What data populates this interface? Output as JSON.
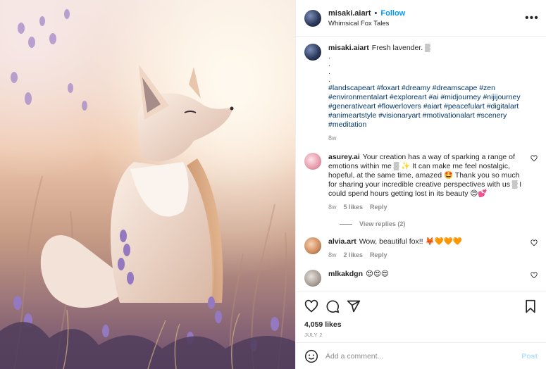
{
  "header": {
    "username": "misaki.aiart",
    "separator": "•",
    "follow_label": "Follow",
    "subtitle": "Whimsical Fox Tales",
    "more_label": "•••"
  },
  "caption": {
    "username": "misaki.aiart",
    "text": "Fresh lavender. ▒",
    "dots": [
      ".",
      ".",
      ".",
      "."
    ],
    "hashtags": "#landscapeart #foxart #dreamy #dreamscape #zen #environmentalart #exploreart #ai #midjourney #nijijourney #generativeart #flowerlovers #aiart #peacefulart #digitalart #animeartstyle #visionaryart #motivationalart #scenery #meditation",
    "age": "8w"
  },
  "comments": [
    {
      "username": "asurey.ai",
      "text": "Your creation has a way of sparking a range of emotions within me ▒ ✨ It can make me feel nostalgic, hopeful, at the same time, amazed 🤩 Thank you so much for sharing your incredible creative perspectives with us ▒ I could spend hours getting lost in its beauty 😍💕",
      "age": "8w",
      "likes": "5 likes",
      "reply": "Reply",
      "view_replies": "View replies (2)"
    },
    {
      "username": "alvia.art",
      "text": "Wow, beautiful fox!! 🦊🧡🧡🧡",
      "age": "8w",
      "likes": "2 likes",
      "reply": "Reply"
    },
    {
      "username": "mlkakdgn",
      "text": "😍😍😍"
    }
  ],
  "actions": {
    "likes": "4,059 likes",
    "date": "JULY 2"
  },
  "add_comment": {
    "placeholder": "Add a comment...",
    "post_label": "Post"
  },
  "icons": [
    "heart-icon",
    "comment-icon",
    "share-icon",
    "bookmark-icon",
    "emoji-icon",
    "more-icon"
  ],
  "colors": {
    "link": "#0095f6",
    "hashtag": "#00376b",
    "muted": "#8e8e8e"
  }
}
